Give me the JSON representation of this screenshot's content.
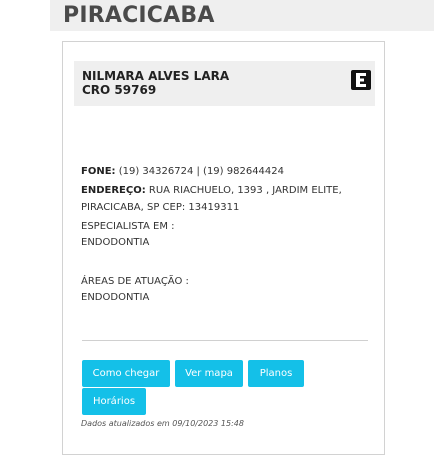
{
  "city": {
    "title": "PIRACICABA"
  },
  "dentist": {
    "name": "NILMARA ALVES LARA",
    "cro": "CRO 59769",
    "phone_label": "FONE:",
    "phone": " (19) 34326724 | (19) 982644424",
    "address_label": "ENDEREÇO:",
    "address_line1": " RUA RIACHUELO, 1393 , JARDIM ELITE,",
    "address_line2": "PIRACICABA, SP CEP: 13419311",
    "specialist_label": "ESPECIALISTA EM :",
    "specialist": "ENDODONTIA",
    "areas_label": "ÁREAS DE ATUAÇÃO :",
    "areas": "ENDODONTIA"
  },
  "buttons": {
    "como_chegar": "Como chegar",
    "ver_mapa": "Ver mapa",
    "planos": "Planos",
    "horarios": "Horários"
  },
  "updated": "Dados atualizados em 09/10/2023 15:48",
  "icons": {
    "badge": "e-logo-icon"
  },
  "colors": {
    "button": "#14c0e8",
    "header_bg": "#efefef"
  }
}
